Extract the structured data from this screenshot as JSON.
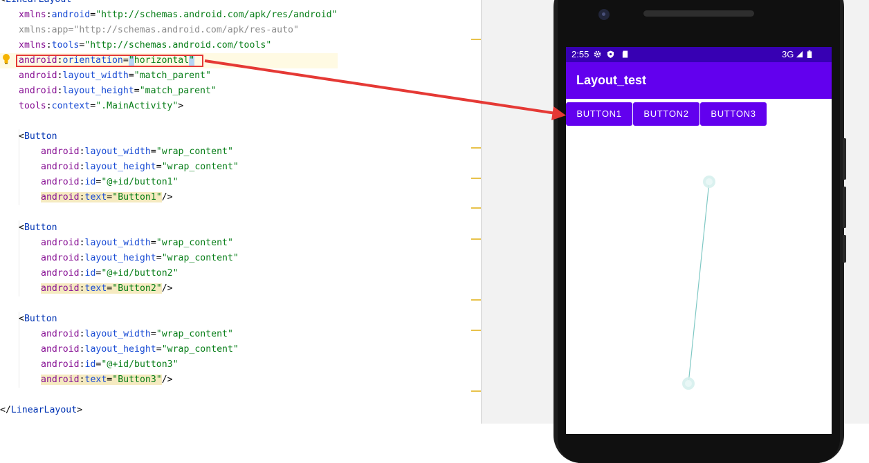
{
  "editor": {
    "lines": [
      {
        "id": "l0",
        "parts": [
          [
            "punct",
            "<"
          ],
          [
            "tag",
            "LinearLayout"
          ]
        ]
      },
      {
        "id": "l1",
        "parts": [
          [
            "ns",
            "xmlns"
          ],
          [
            "punct",
            ":"
          ],
          [
            "attr",
            "android"
          ],
          [
            "punct",
            "="
          ],
          [
            "val",
            "\"http://schemas.android.com/apk/res/android\""
          ]
        ]
      },
      {
        "id": "l2",
        "parts": [
          [
            "gray",
            "xmlns:app=\"http://schemas.android.com/apk/res-auto\""
          ]
        ]
      },
      {
        "id": "l3",
        "parts": [
          [
            "ns",
            "xmlns"
          ],
          [
            "punct",
            ":"
          ],
          [
            "attr",
            "tools"
          ],
          [
            "punct",
            "="
          ],
          [
            "val",
            "\"http://schemas.android.com/tools\""
          ]
        ]
      },
      {
        "id": "l4",
        "parts": [
          [
            "ns",
            "android"
          ],
          [
            "punct",
            ":"
          ],
          [
            "attr",
            "orientation"
          ],
          [
            "punct",
            "="
          ],
          [
            "val",
            "\""
          ],
          [
            "val",
            "horizontal"
          ],
          [
            "val",
            "\""
          ]
        ]
      },
      {
        "id": "l5",
        "parts": [
          [
            "ns",
            "android"
          ],
          [
            "punct",
            ":"
          ],
          [
            "attr",
            "layout_width"
          ],
          [
            "punct",
            "="
          ],
          [
            "val",
            "\"match_parent\""
          ]
        ]
      },
      {
        "id": "l6",
        "parts": [
          [
            "ns",
            "android"
          ],
          [
            "punct",
            ":"
          ],
          [
            "attr",
            "layout_height"
          ],
          [
            "punct",
            "="
          ],
          [
            "val",
            "\"match_parent\""
          ]
        ]
      },
      {
        "id": "l7",
        "parts": [
          [
            "ns",
            "tools"
          ],
          [
            "punct",
            ":"
          ],
          [
            "attr",
            "context"
          ],
          [
            "punct",
            "="
          ],
          [
            "val",
            "\".MainActivity\""
          ],
          [
            "punct",
            ">"
          ]
        ]
      },
      {
        "id": "l8",
        "parts": []
      },
      {
        "id": "l9",
        "parts": [
          [
            "punct",
            "<"
          ],
          [
            "tag",
            "Button"
          ]
        ]
      },
      {
        "id": "l10",
        "parts": [
          [
            "ns",
            "android"
          ],
          [
            "punct",
            ":"
          ],
          [
            "attr",
            "layout_width"
          ],
          [
            "punct",
            "="
          ],
          [
            "val",
            "\"wrap_content\""
          ]
        ]
      },
      {
        "id": "l11",
        "parts": [
          [
            "ns",
            "android"
          ],
          [
            "punct",
            ":"
          ],
          [
            "attr",
            "layout_height"
          ],
          [
            "punct",
            "="
          ],
          [
            "val",
            "\"wrap_content\""
          ]
        ]
      },
      {
        "id": "l12",
        "parts": [
          [
            "ns",
            "android"
          ],
          [
            "punct",
            ":"
          ],
          [
            "attr",
            "id"
          ],
          [
            "punct",
            "="
          ],
          [
            "val",
            "\"@+id/button1\""
          ]
        ]
      },
      {
        "id": "l13",
        "parts": [
          [
            "ns",
            "android"
          ],
          [
            "punct",
            ":"
          ],
          [
            "attr",
            "text"
          ],
          [
            "punct",
            "="
          ],
          [
            "val",
            "\"Button1\""
          ],
          [
            "punct",
            "/>"
          ]
        ]
      },
      {
        "id": "l14",
        "parts": []
      },
      {
        "id": "l15",
        "parts": [
          [
            "punct",
            "<"
          ],
          [
            "tag",
            "Button"
          ]
        ]
      },
      {
        "id": "l16",
        "parts": [
          [
            "ns",
            "android"
          ],
          [
            "punct",
            ":"
          ],
          [
            "attr",
            "layout_width"
          ],
          [
            "punct",
            "="
          ],
          [
            "val",
            "\"wrap_content\""
          ]
        ]
      },
      {
        "id": "l17",
        "parts": [
          [
            "ns",
            "android"
          ],
          [
            "punct",
            ":"
          ],
          [
            "attr",
            "layout_height"
          ],
          [
            "punct",
            "="
          ],
          [
            "val",
            "\"wrap_content\""
          ]
        ]
      },
      {
        "id": "l18",
        "parts": [
          [
            "ns",
            "android"
          ],
          [
            "punct",
            ":"
          ],
          [
            "attr",
            "id"
          ],
          [
            "punct",
            "="
          ],
          [
            "val",
            "\"@+id/button2\""
          ]
        ]
      },
      {
        "id": "l19",
        "parts": [
          [
            "ns",
            "android"
          ],
          [
            "punct",
            ":"
          ],
          [
            "attr",
            "text"
          ],
          [
            "punct",
            "="
          ],
          [
            "val",
            "\"Button2\""
          ],
          [
            "punct",
            "/>"
          ]
        ]
      },
      {
        "id": "l20",
        "parts": []
      },
      {
        "id": "l21",
        "parts": [
          [
            "punct",
            "<"
          ],
          [
            "tag",
            "Button"
          ]
        ]
      },
      {
        "id": "l22",
        "parts": [
          [
            "ns",
            "android"
          ],
          [
            "punct",
            ":"
          ],
          [
            "attr",
            "layout_width"
          ],
          [
            "punct",
            "="
          ],
          [
            "val",
            "\"wrap_content\""
          ]
        ]
      },
      {
        "id": "l23",
        "parts": [
          [
            "ns",
            "android"
          ],
          [
            "punct",
            ":"
          ],
          [
            "attr",
            "layout_height"
          ],
          [
            "punct",
            "="
          ],
          [
            "val",
            "\"wrap_content\""
          ]
        ]
      },
      {
        "id": "l24",
        "parts": [
          [
            "ns",
            "android"
          ],
          [
            "punct",
            ":"
          ],
          [
            "attr",
            "id"
          ],
          [
            "punct",
            "="
          ],
          [
            "val",
            "\"@+id/button3\""
          ]
        ]
      },
      {
        "id": "l25",
        "parts": [
          [
            "ns",
            "android"
          ],
          [
            "punct",
            ":"
          ],
          [
            "attr",
            "text"
          ],
          [
            "punct",
            "="
          ],
          [
            "val",
            "\"Button3\""
          ],
          [
            "punct",
            "/>"
          ]
        ]
      },
      {
        "id": "l26",
        "parts": []
      },
      {
        "id": "l27",
        "parts": [
          [
            "punct",
            "</"
          ],
          [
            "tag",
            "LinearLayout"
          ],
          [
            "punct",
            ">"
          ]
        ]
      }
    ]
  },
  "phone": {
    "status_time": "2:55",
    "status_network": "3G",
    "status_icons": [
      "gear-icon",
      "shield-icon",
      "sdcard-icon",
      "signal-icon",
      "battery-icon"
    ],
    "app_title": "Layout_test",
    "buttons": [
      "BUTTON1",
      "BUTTON2",
      "BUTTON3"
    ]
  },
  "colors": {
    "status_bar": "#3700b3",
    "app_bar": "#6200ee",
    "button": "#6200ee",
    "annotation": "#e53935"
  }
}
